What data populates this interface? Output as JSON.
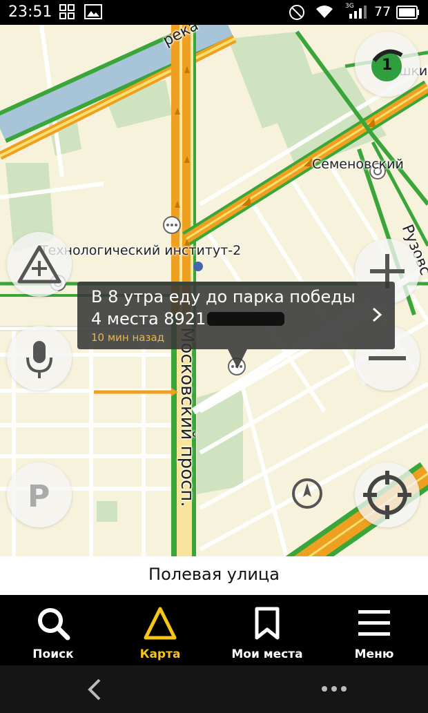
{
  "status_bar": {
    "time": "23:51",
    "network": "3G",
    "battery": "77"
  },
  "map": {
    "labels": {
      "river": "река",
      "tech_institute": "Технологический институт-2",
      "semenovsky": "Семеновский",
      "ruzovskaya": "Рузовс",
      "pushkinskaya": "шки",
      "moskovsky": "Московский просп."
    },
    "traffic_score": "1",
    "popup": {
      "line1": "В 8 утра еду до парка победы",
      "line2": "4 места 8921",
      "time_ago": "10 мин назад"
    },
    "current_street": "Полевая улица"
  },
  "map_buttons": [
    "road-event-add-icon",
    "microphone-icon",
    "parking-icon",
    "zoom-in-icon",
    "zoom-out-icon",
    "compass-icon",
    "locate-me-icon"
  ],
  "tabs": [
    {
      "label": "Поиск",
      "icon": "search-icon"
    },
    {
      "label": "Карта",
      "icon": "map-arrow-icon"
    },
    {
      "label": "Мои места",
      "icon": "bookmark-icon"
    },
    {
      "label": "Меню",
      "icon": "menu-icon"
    }
  ],
  "colors": {
    "accent": "#f5c518",
    "traffic_green": "#3aa63a",
    "road_orange": "#f0a020"
  }
}
